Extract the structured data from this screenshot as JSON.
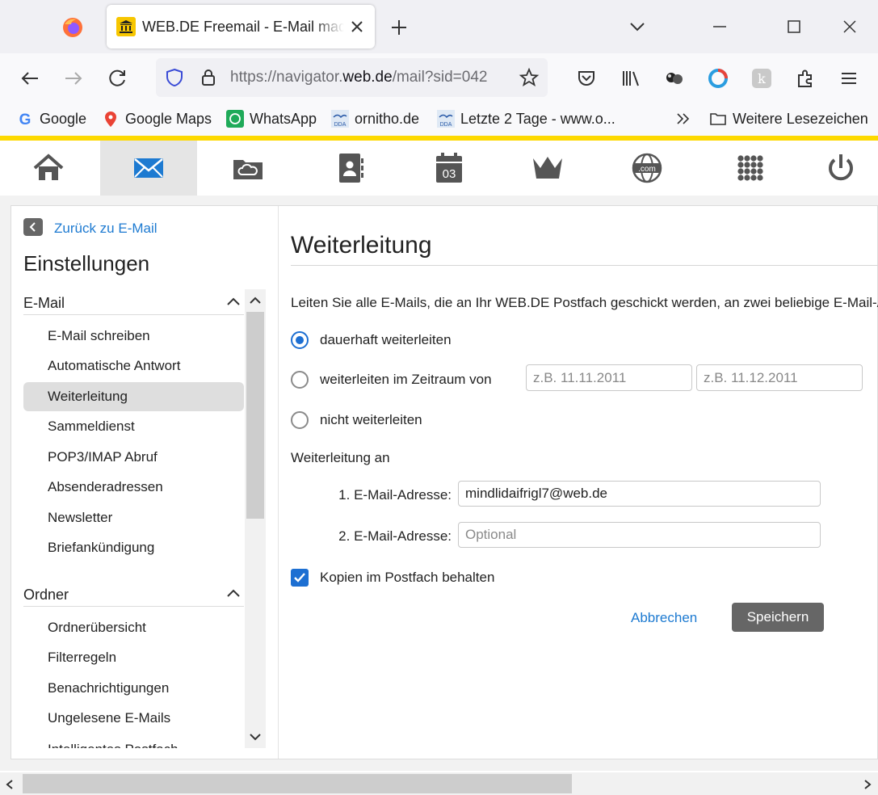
{
  "browser": {
    "tab_title": "WEB.DE Freemail - E-Mail made in Germany",
    "url_prefix": "https://navigator.",
    "url_domain": "web.de",
    "url_suffix": "/mail?sid=042",
    "bookmarks": [
      {
        "label": "Google",
        "icon": "google-icon"
      },
      {
        "label": "Google Maps",
        "icon": "google-maps-icon"
      },
      {
        "label": "WhatsApp",
        "icon": "whatsapp-icon"
      },
      {
        "label": "ornitho.de",
        "icon": "dda-icon"
      },
      {
        "label": "Letzte 2 Tage - www.o...",
        "icon": "dda-icon"
      }
    ],
    "other_bookmarks": "Weitere Lesezeichen"
  },
  "appnav": {
    "calendar_day": "03",
    "globe_label": ".com",
    "items": [
      "home",
      "mail",
      "cloud",
      "contacts",
      "calendar",
      "premium",
      "domains",
      "apps",
      "logout"
    ]
  },
  "sidebar": {
    "back_label": "Zurück zu E-Mail",
    "title": "Einstellungen",
    "sections": [
      {
        "title": "E-Mail",
        "items": [
          "E-Mail schreiben",
          "Automatische Antwort",
          "Weiterleitung",
          "Sammeldienst",
          "POP3/IMAP Abruf",
          "Absenderadressen",
          "Newsletter",
          "Briefankündigung"
        ]
      },
      {
        "title": "Ordner",
        "items": [
          "Ordnerübersicht",
          "Filterregeln",
          "Benachrichtigungen",
          "Ungelesene E-Mails",
          "Intelligentes Postfach"
        ]
      }
    ],
    "selected": "Weiterleitung"
  },
  "main": {
    "title": "Weiterleitung",
    "intro": "Leiten Sie alle E-Mails, die an Ihr WEB.DE Postfach geschickt werden, an zwei beliebige E-Mail-Adressen weiter.",
    "options": [
      {
        "label": "dauerhaft weiterleiten",
        "checked": true
      },
      {
        "label": "weiterleiten im Zeitraum von",
        "checked": false
      },
      {
        "label": "nicht weiterleiten",
        "checked": false
      }
    ],
    "date_from_placeholder": "z.B. 11.11.2011",
    "date_to_placeholder": "z.B. 11.12.2011",
    "forward_to_label": "Weiterleitung an",
    "address1_label": "1. E-Mail-Adresse:",
    "address1_value": "mindlidaifrigl7@web.de",
    "address2_label": "2. E-Mail-Adresse:",
    "address2_placeholder": "Optional",
    "keep_copies_label": "Kopien im Postfach behalten",
    "keep_copies_checked": true,
    "cancel_label": "Abbrechen",
    "save_label": "Speichern"
  },
  "colors": {
    "brand_yellow": "#fdd900",
    "accent_blue": "#1d6fd2",
    "link_blue": "#1d7ad1",
    "button_gray": "#666666"
  }
}
